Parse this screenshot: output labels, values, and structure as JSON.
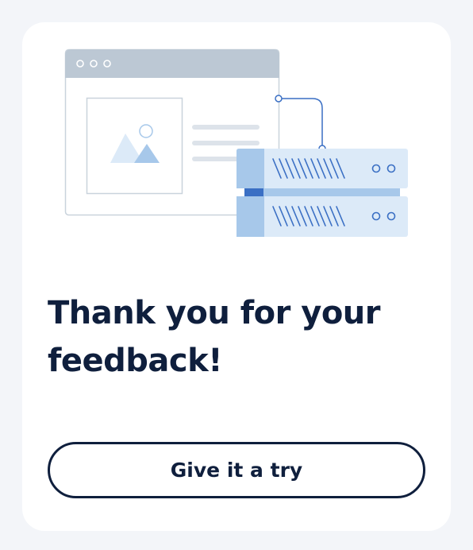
{
  "card": {
    "title": "Thank you for your feedback!",
    "button_label": "Give it a try"
  },
  "illustration": {
    "icons": [
      "browser-window-icon",
      "image-placeholder-icon",
      "server-stack-icon"
    ]
  },
  "colors": {
    "background": "#f3f5f9",
    "card": "#ffffff",
    "text": "#0f1f3d",
    "accent_blue": "#3a6fc4",
    "light_blue": "#a7c8ea",
    "pale_blue": "#dceaf8",
    "gray": "#bcc8d4"
  }
}
